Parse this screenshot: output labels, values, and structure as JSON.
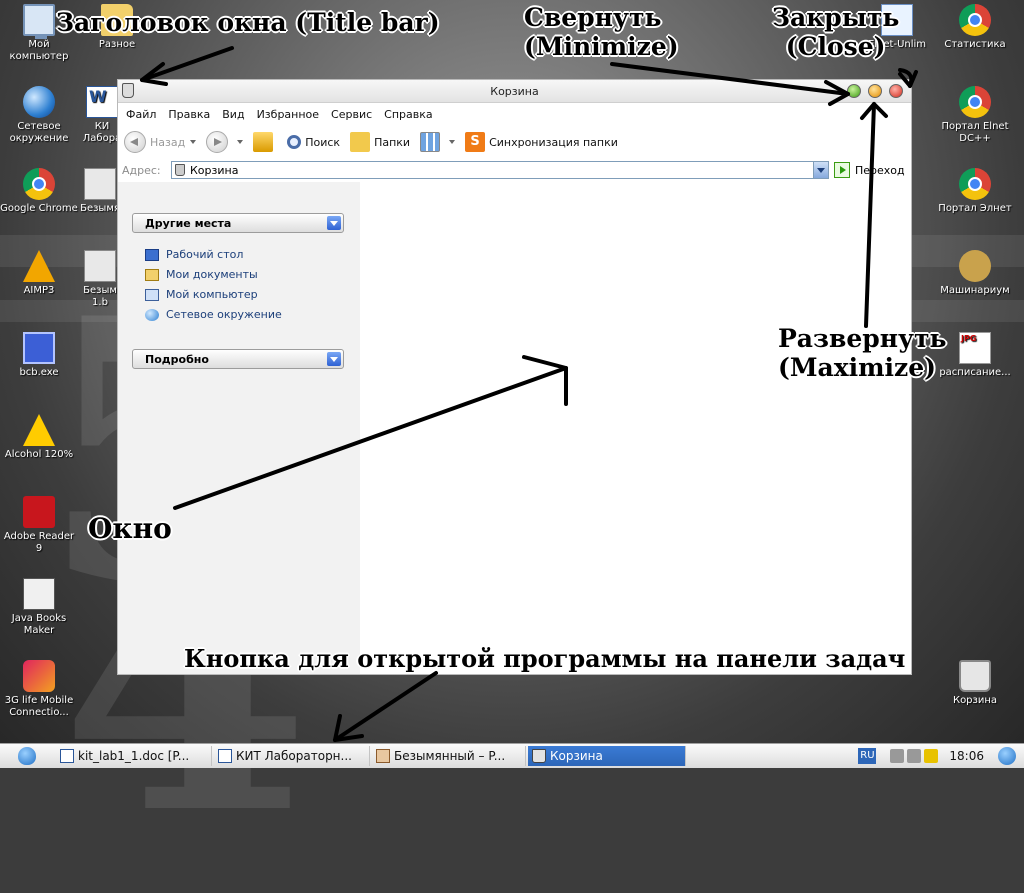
{
  "desktop": {
    "left_icons": [
      {
        "label": "Мой компьютер",
        "icon": "computer-icon"
      },
      {
        "label": "Сетевое окружение",
        "icon": "network-icon"
      },
      {
        "label": "Google Chrome",
        "icon": "chrome-icon"
      },
      {
        "label": "AIMP3",
        "icon": "aimp-icon"
      },
      {
        "label": "bcb.exe",
        "icon": "exe-icon"
      },
      {
        "label": "Alcohol 120%",
        "icon": "alcohol-icon"
      },
      {
        "label": "Adobe Reader 9",
        "icon": "pdf-icon"
      },
      {
        "label": "Java Books Maker",
        "icon": "books-icon"
      },
      {
        "label": "3G life Mobile Connectio...",
        "icon": "modem-icon"
      }
    ],
    "second_column": [
      {
        "label": "Разное",
        "icon": "folder-icon"
      },
      {
        "label": "КИ Лабора",
        "icon": "word-doc-icon"
      },
      {
        "label": "Безымя",
        "icon": "bmp-icon"
      },
      {
        "label": "Безым 1.b",
        "icon": "bmp-icon"
      }
    ],
    "right_icons": [
      {
        "label": "Elnet-Unlim",
        "icon": "elnet-icon"
      },
      {
        "label": "Статистика",
        "icon": "chrome-icon"
      },
      {
        "label": "Портал Elnet DC++",
        "icon": "chrome-icon"
      },
      {
        "label": "Портал Элнет",
        "icon": "chrome-icon"
      },
      {
        "label": "Машинариум",
        "icon": "machinarium-icon"
      },
      {
        "label": "расписание...",
        "icon": "jpg-icon"
      },
      {
        "label": "Корзина",
        "icon": "recycle-bin-icon"
      }
    ]
  },
  "window": {
    "title": "Корзина",
    "menu": [
      "Файл",
      "Правка",
      "Вид",
      "Избранное",
      "Сервис",
      "Справка"
    ],
    "toolbar": {
      "back": "Назад",
      "search": "Поиск",
      "folders": "Папки",
      "sync": "Синхронизация папки"
    },
    "address": {
      "label": "Адрес:",
      "value": "Корзина",
      "go": "Переход"
    },
    "side_panel": {
      "other_places_title": "Другие места",
      "places": [
        "Рабочий стол",
        "Мои документы",
        "Мой компьютер",
        "Сетевое окружение"
      ],
      "details_title": "Подробно"
    }
  },
  "annotations": {
    "title_bar": "Заголовок окна (Title bar)",
    "minimize": "Свернуть\n(Minimize)",
    "close": "Закрыть\n(Close)",
    "maximize": "Развернуть\n(Maximize)",
    "window": "Окно",
    "taskbar_button": "Кнопка для открытой программы на панели задач"
  },
  "taskbar": {
    "tasks": [
      {
        "label": "kit_lab1_1.doc [P...",
        "active": false
      },
      {
        "label": "КИТ Лабораторн...",
        "active": false
      },
      {
        "label": "Безымянный – P...",
        "active": false
      },
      {
        "label": "Корзина",
        "active": true
      }
    ],
    "language": "RU",
    "clock": "18:06"
  },
  "colors": {
    "active_task": "#2d66b8",
    "minimize_button": "#3c9c12",
    "maximize_button": "#e38b00",
    "close_button": "#d22b1d"
  }
}
